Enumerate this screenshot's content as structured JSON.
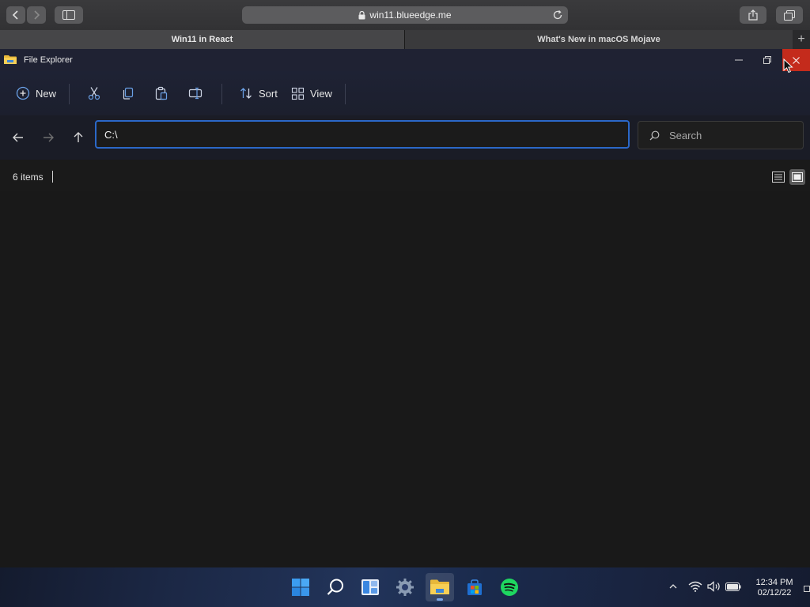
{
  "browser": {
    "url": "win11.blueedge.me",
    "tabs": [
      {
        "label": "Win11 in React",
        "active": true
      },
      {
        "label": "What's New in macOS Mojave",
        "active": false
      }
    ],
    "new_tab_label": "+"
  },
  "window": {
    "title": "File Explorer",
    "close_color": "#c42b1c"
  },
  "toolbar": {
    "new_label": "New",
    "sort_label": "Sort",
    "view_label": "View",
    "icons": [
      "add-circle-icon",
      "cut-icon",
      "copy-icon",
      "paste-icon",
      "rename-icon",
      "sort-icon",
      "view-grid-icon"
    ]
  },
  "address": {
    "path": "C:\\",
    "search_placeholder": "Search"
  },
  "status": {
    "item_count": "6 items"
  },
  "taskbar": {
    "apps": [
      "start-icon",
      "search-icon",
      "widgets-icon",
      "settings-icon",
      "file-explorer-icon",
      "store-icon",
      "spotify-icon"
    ],
    "time": "12:34 PM",
    "date": "02/12/22"
  },
  "colors": {
    "accent": "#2b68c8",
    "titlebar": "#1f2233",
    "background": "#191919"
  }
}
